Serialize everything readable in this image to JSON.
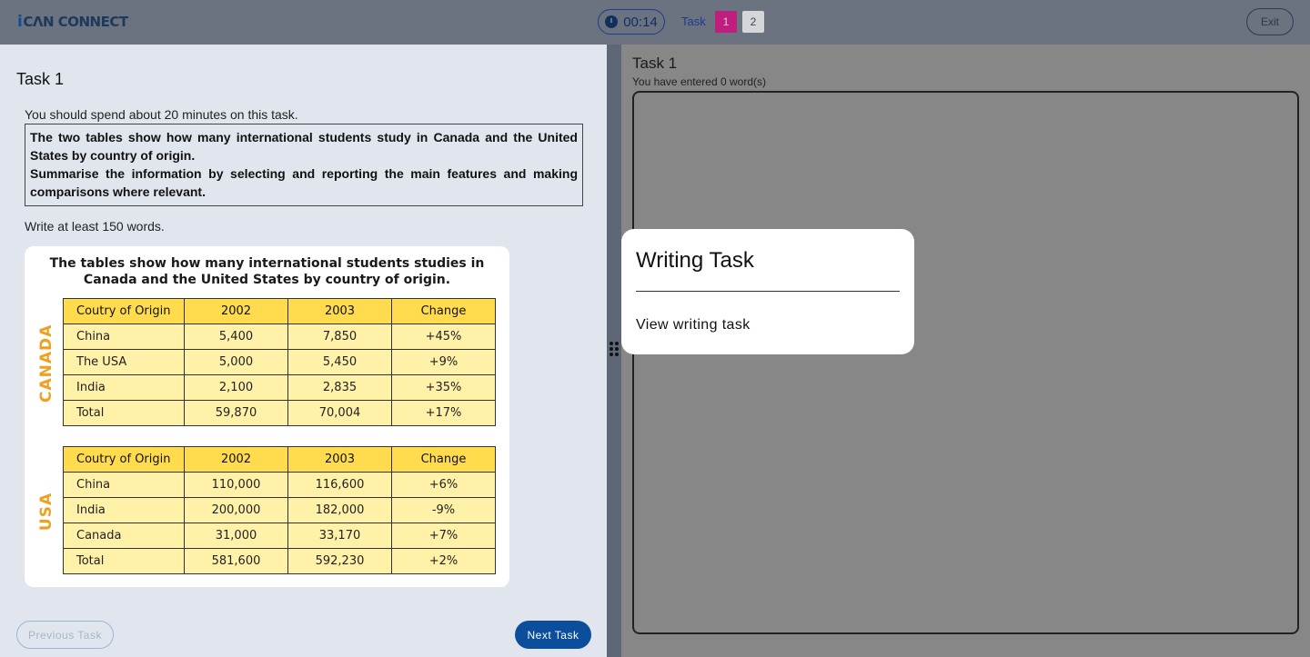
{
  "header": {
    "logo_icon": "i",
    "logo_text": "CΛN CONNECT",
    "timer": "00:14",
    "clock_icon": "clock-icon",
    "task_label": "Task",
    "task_buttons": [
      "1",
      "2"
    ],
    "exit_label": "Exit",
    "colors": {
      "bar": "#6b7280",
      "active_task": "#be1f7f",
      "primary": "#0b4f9c"
    }
  },
  "left_panel": {
    "title": "Task 1",
    "instruction": "You should spend about 20 minutes on this task.",
    "task_text_1": "The two tables show how many international students study in Canada and the United States by country of origin.",
    "task_text_2": "Summarise the information by selecting and reporting the main features and making comparisons where relevant.",
    "min_words": "Write at least 150 words.",
    "figure": {
      "title": "The tables show how many international students studies in Canada and the United States by country of origin.",
      "tables": [
        {
          "label": "CANADA",
          "headers": [
            "Coutry of Origin",
            "2002",
            "2003",
            "Change"
          ],
          "rows": [
            [
              "China",
              "5,400",
              "7,850",
              "+45%"
            ],
            [
              "The USA",
              "5,000",
              "5,450",
              "+9%"
            ],
            [
              "India",
              "2,100",
              "2,835",
              "+35%"
            ],
            [
              "Total",
              "59,870",
              "70,004",
              "+17%"
            ]
          ]
        },
        {
          "label": "USA",
          "headers": [
            "Coutry of Origin",
            "2002",
            "2003",
            "Change"
          ],
          "rows": [
            [
              "China",
              "110,000",
              "116,600",
              "+6%"
            ],
            [
              "India",
              "200,000",
              "182,000",
              "-9%"
            ],
            [
              "Canada",
              "31,000",
              "33,170",
              "+7%"
            ],
            [
              "Total",
              "581,600",
              "592,230",
              "+2%"
            ]
          ]
        }
      ]
    },
    "prev_label": "Previous Task",
    "next_label": "Next Task"
  },
  "right_panel": {
    "title": "Task 1",
    "word_count": "You have entered 0 word(s)"
  },
  "popup": {
    "title": "Writing Task",
    "link": "View writing task"
  }
}
